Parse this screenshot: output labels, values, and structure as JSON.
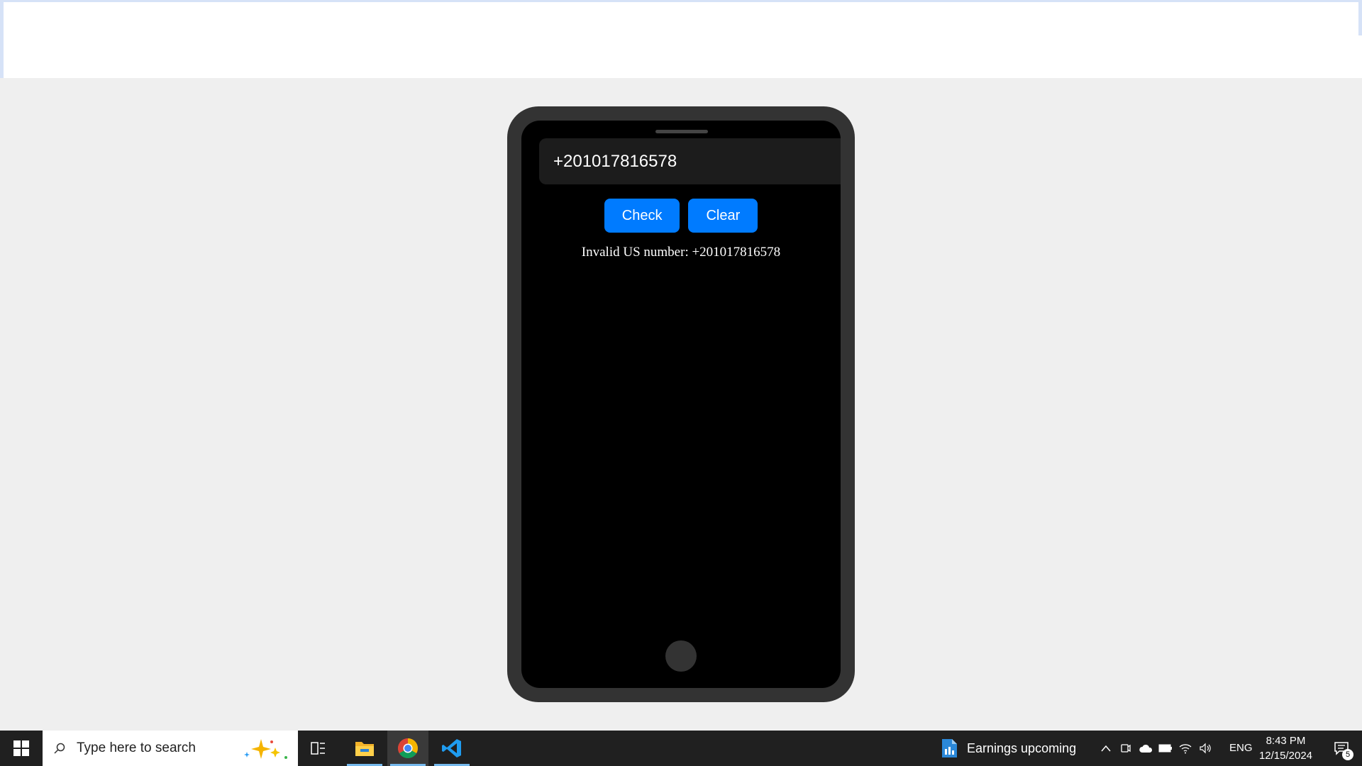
{
  "app": {
    "input_value": "+201017816578",
    "check_label": "Check",
    "clear_label": "Clear",
    "result_text": "Invalid US number: +201017816578"
  },
  "taskbar": {
    "search_placeholder": "Type here to search",
    "news_text": "Earnings upcoming",
    "language": "ENG",
    "time": "8:43 PM",
    "date": "12/15/2024",
    "notification_count": "5",
    "pinned_apps": [
      "task-view-icon",
      "file-explorer-icon",
      "chrome-icon",
      "vscode-icon"
    ]
  },
  "colors": {
    "accent": "#007bff",
    "phone_frame": "#333333",
    "screen": "#000000",
    "page_background": "#efefef",
    "taskbar": "#202020"
  }
}
